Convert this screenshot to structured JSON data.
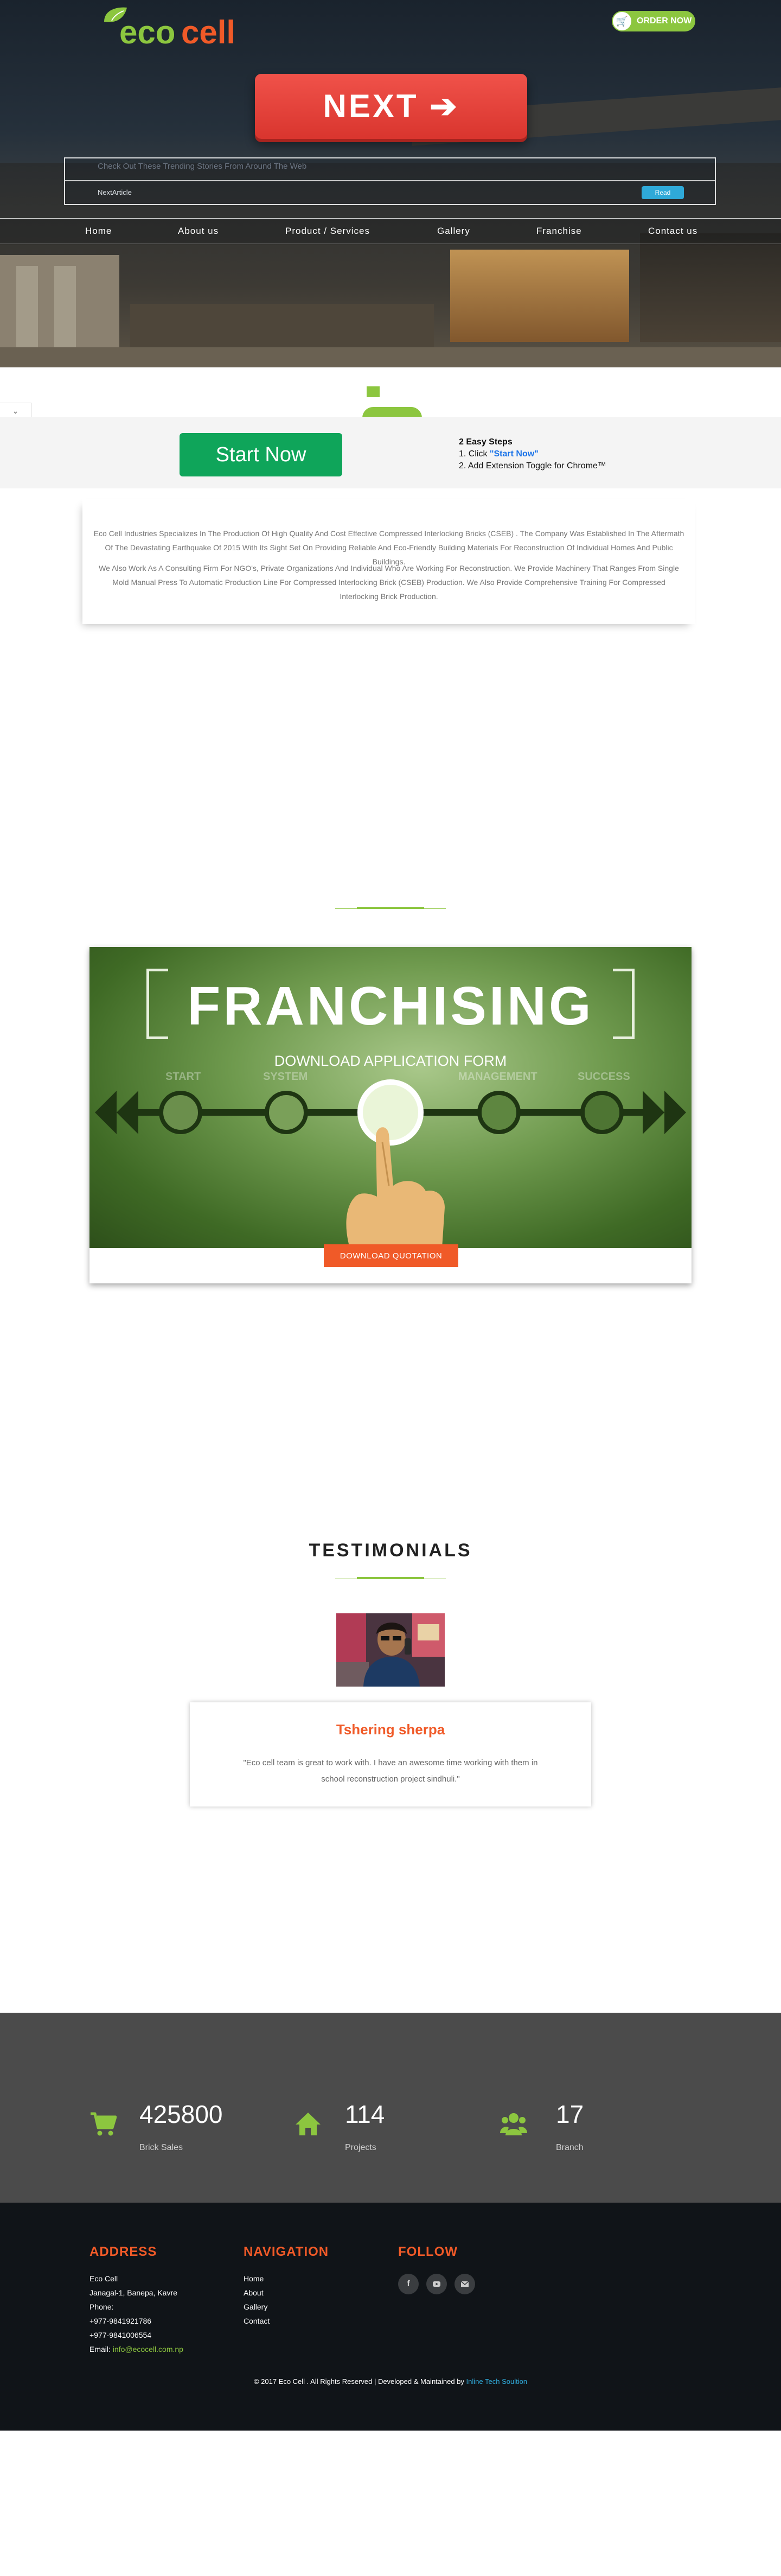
{
  "header": {
    "logo": {
      "word_a": "eco",
      "word_b": "cell"
    },
    "order_now": "ORDER NOW",
    "next_button": "NEXT ➔"
  },
  "extension_box": {
    "title": "Check Out These Trending Stories From Around The Web",
    "link": "NextArticle",
    "button": "Read"
  },
  "nav": [
    "Home",
    "About us",
    "Product / Services",
    "Gallery",
    "Franchise",
    "Contact us"
  ],
  "start_bar": {
    "button": "Start Now",
    "steps_title": "2 Easy Steps",
    "step1_prefix": "1. Click ",
    "step1_highlight": "\"Start Now\"",
    "step2": "2. Add Extension Toggle for Chrome™"
  },
  "about": {
    "p1": "Eco Cell Industries Specializes In The Production Of High Quality And Cost Effective Compressed Interlocking Bricks (CSEB) . The Company Was Established In The Aftermath Of The Devastating Earthquake Of 2015 With Its Sight Set On Providing Reliable And Eco-Friendly Building Materials For Reconstruction Of Individual Homes And Public Buildings.",
    "p2": "We Also Work As A Consulting Firm For NGO's, Private Organizations And Individual Who Are Working For Reconstruction. We Provide Machinery That Ranges From Single Mold Manual Press To Automatic Production Line For Compressed Interlocking Brick (CSEB) Production. We Also Provide Comprehensive Training For Compressed Interlocking Brick Production."
  },
  "franchise": {
    "title": "FRANCHISING",
    "subtitle": "DOWNLOAD APPLICATION FORM",
    "stages": [
      "START",
      "SYSTEM",
      "MANAGEMENT",
      "SUCCESS"
    ],
    "button": "DOWNLOAD QUOTATION"
  },
  "testimonials": {
    "title": "TESTIMONIALS",
    "name": "Tshering sherpa",
    "quote": "\"Eco cell team is great to work with. I have an awesome time working with them in school reconstruction project sindhuli.\""
  },
  "stats": [
    {
      "icon": "cart-icon",
      "value": "425800",
      "label": "Brick Sales"
    },
    {
      "icon": "home-icon",
      "value": "114",
      "label": "Projects"
    },
    {
      "icon": "users-icon",
      "value": "17",
      "label": "Branch"
    }
  ],
  "footer": {
    "address_head": "ADDRESS",
    "address": [
      "Eco Cell",
      "Janagal-1, Banepa, Kavre",
      "Phone:",
      "+977-9841921786",
      "+977-9841006554"
    ],
    "email_label": "Email: ",
    "email": "info@ecocell.com.np",
    "nav_head": "NAVIGATION",
    "nav_links": [
      "Home",
      "About",
      "Gallery",
      "Contact"
    ],
    "follow_head": "FOLLOW",
    "social": [
      "facebook-icon",
      "youtube-icon",
      "mail-icon"
    ],
    "copyright": "© 2017 Eco Cell . All Rights Reserved | Developed & Maintained by ",
    "developer": "Inline Tech Soultion"
  },
  "colors": {
    "brand_green": "#8cc63f",
    "brand_orange": "#f05a28",
    "next_red": "#e2403a",
    "start_green": "#0fa55a"
  }
}
